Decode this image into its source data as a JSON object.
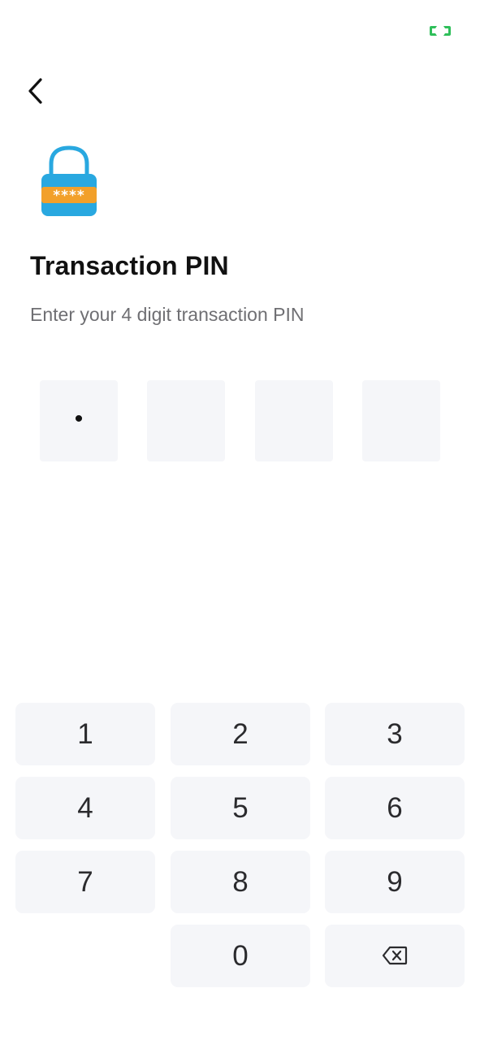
{
  "status": {
    "icon": "green-bracket-indicator-icon",
    "color": "#2fbf5a"
  },
  "header": {
    "back_icon": "chevron-left-icon"
  },
  "hero": {
    "icon": "padlock-icon",
    "colors": {
      "lock_body": "#29a8e0",
      "shackle": "#29a8e0",
      "band": "#f2a02a"
    },
    "masked_text": "****"
  },
  "title": "Transaction PIN",
  "subtitle": "Enter your 4 digit transaction PIN",
  "pin": {
    "length": 4,
    "filled": 1,
    "mask_char": "•",
    "boxes": [
      "•",
      "",
      "",
      ""
    ]
  },
  "keypad": {
    "rows": [
      [
        "1",
        "2",
        "3"
      ],
      [
        "4",
        "5",
        "6"
      ],
      [
        "7",
        "8",
        "9"
      ],
      [
        "",
        "0",
        "backspace"
      ]
    ],
    "backspace_icon": "backspace-icon"
  }
}
